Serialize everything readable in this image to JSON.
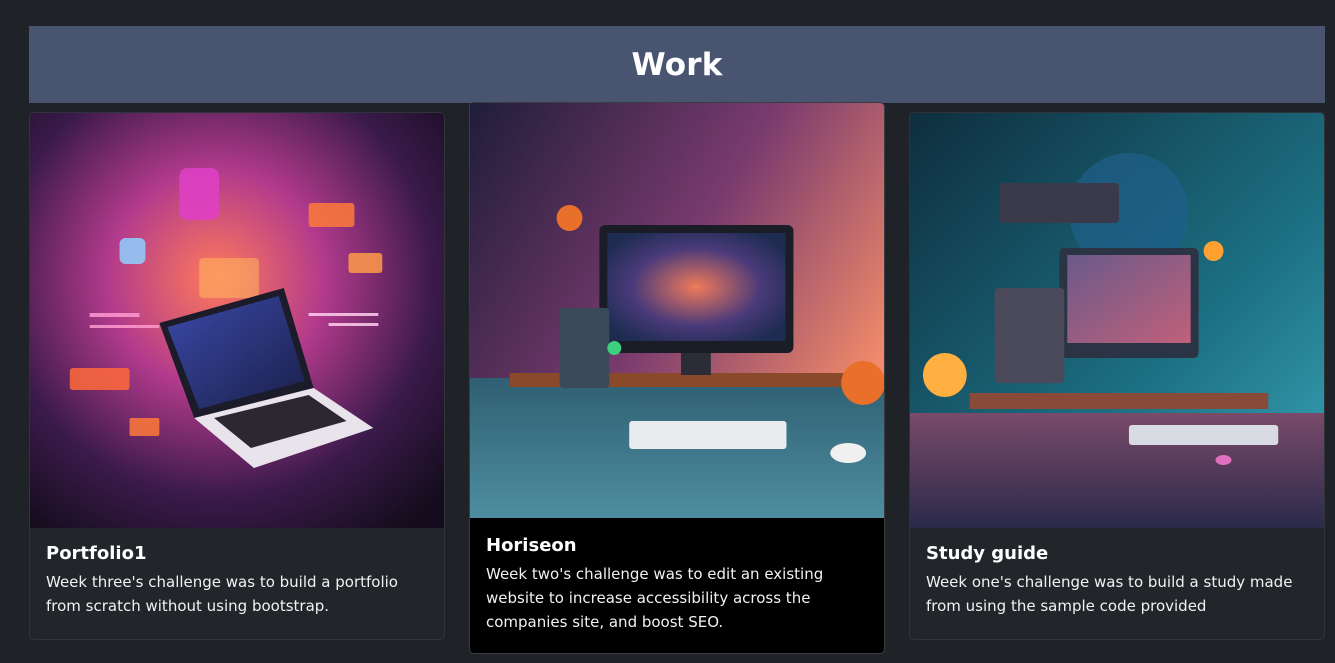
{
  "header": {
    "title": "Work"
  },
  "cards": [
    {
      "title": "Portfolio1",
      "text": "Week three's challenge was to build a portfolio from scratch without using bootstrap.",
      "image_icon": "laptop-illustration-image"
    },
    {
      "title": "Horiseon",
      "text": "Week two's challenge was to edit an existing website to increase accessibility across the companies site, and boost SEO.",
      "image_icon": "desktop-workstation-illustration-image"
    },
    {
      "title": "Study guide",
      "text": "Week one's challenge was to build a study made from using the sample code provided",
      "image_icon": "retro-computer-desk-illustration-image"
    }
  ],
  "colors": {
    "page_background": "#1f2227",
    "banner_background": "#485470",
    "card_background": "#22252a",
    "featured_card_background": "#000000"
  }
}
